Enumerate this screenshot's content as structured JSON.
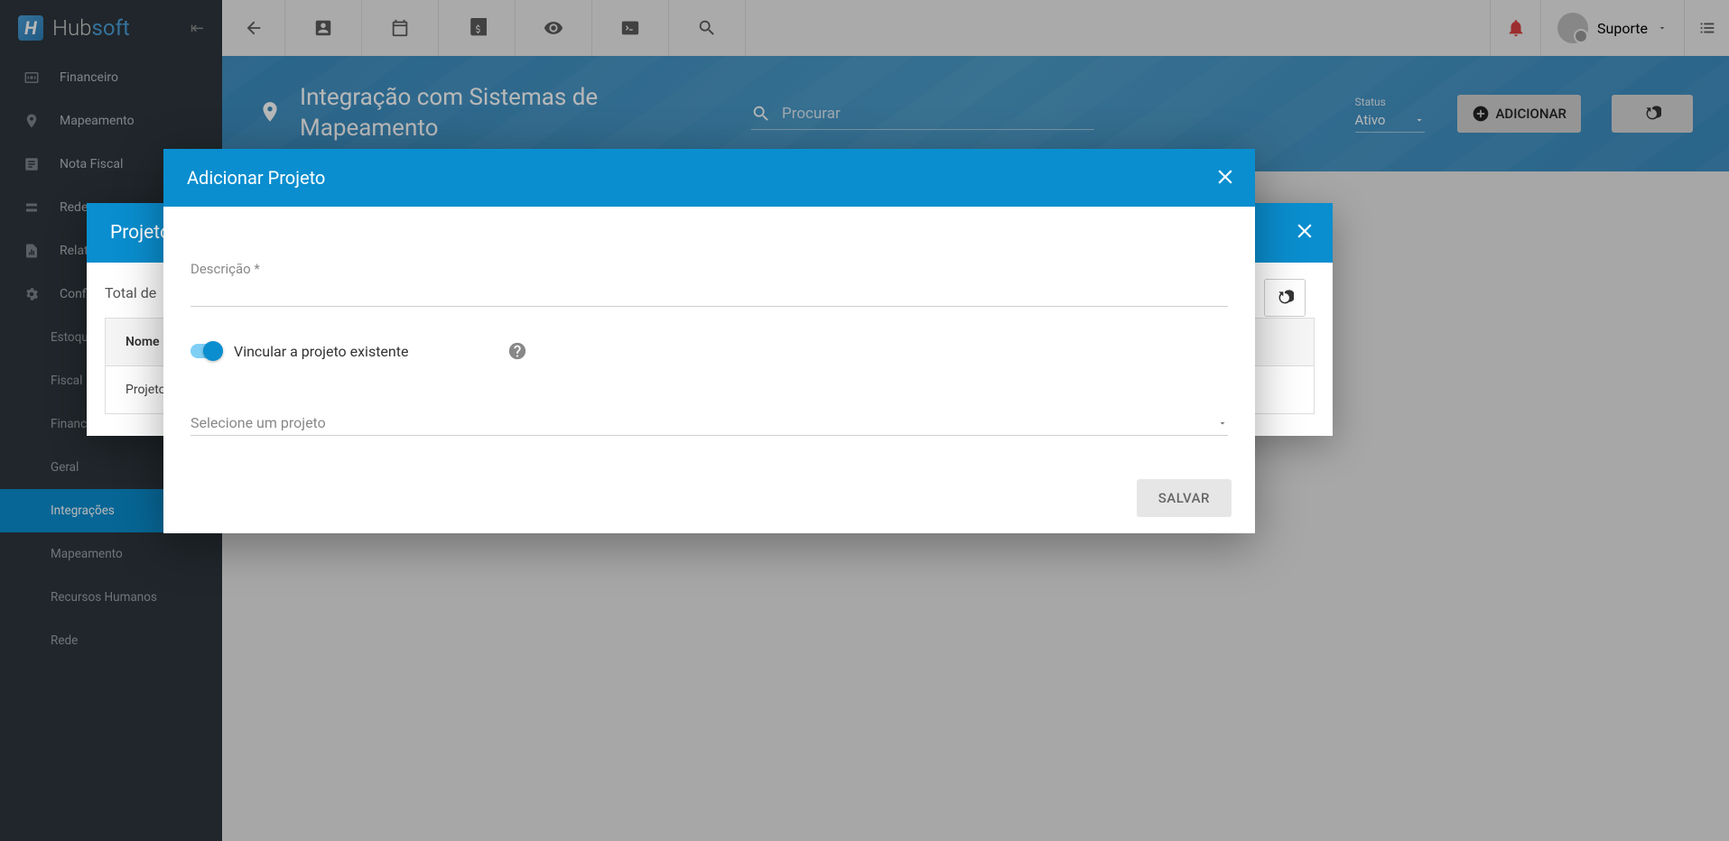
{
  "brand": {
    "name_a": "Hub",
    "name_b": "soft"
  },
  "sidebar": {
    "items": [
      {
        "label": "Financeiro"
      },
      {
        "label": "Mapeamento"
      },
      {
        "label": "Nota Fiscal"
      },
      {
        "label": "Rede"
      },
      {
        "label": "Relatórios"
      },
      {
        "label": "Configurações"
      }
    ],
    "subitems": [
      {
        "label": "Estoque"
      },
      {
        "label": "Fiscal"
      },
      {
        "label": "Financeiro"
      },
      {
        "label": "Geral"
      },
      {
        "label": "Integrações",
        "active": true
      },
      {
        "label": "Mapeamento"
      },
      {
        "label": "Recursos Humanos"
      },
      {
        "label": "Rede"
      }
    ]
  },
  "topbar": {
    "user_label": "Suporte"
  },
  "page": {
    "title": "Integração com Sistemas de Mapeamento",
    "search_placeholder": "Procurar",
    "status_label": "Status",
    "status_value": "Ativo",
    "add_button": "ADICIONAR"
  },
  "modal_projects": {
    "title": "Projetos",
    "total_label": "Total de ",
    "col_name": "Nome",
    "row1": "Projeto G"
  },
  "modal_add": {
    "title": "Adicionar Projeto",
    "description_label": "Descrição *",
    "toggle_label": "Vincular a projeto existente",
    "select_placeholder": "Selecione um projeto",
    "save_button": "SALVAR"
  }
}
